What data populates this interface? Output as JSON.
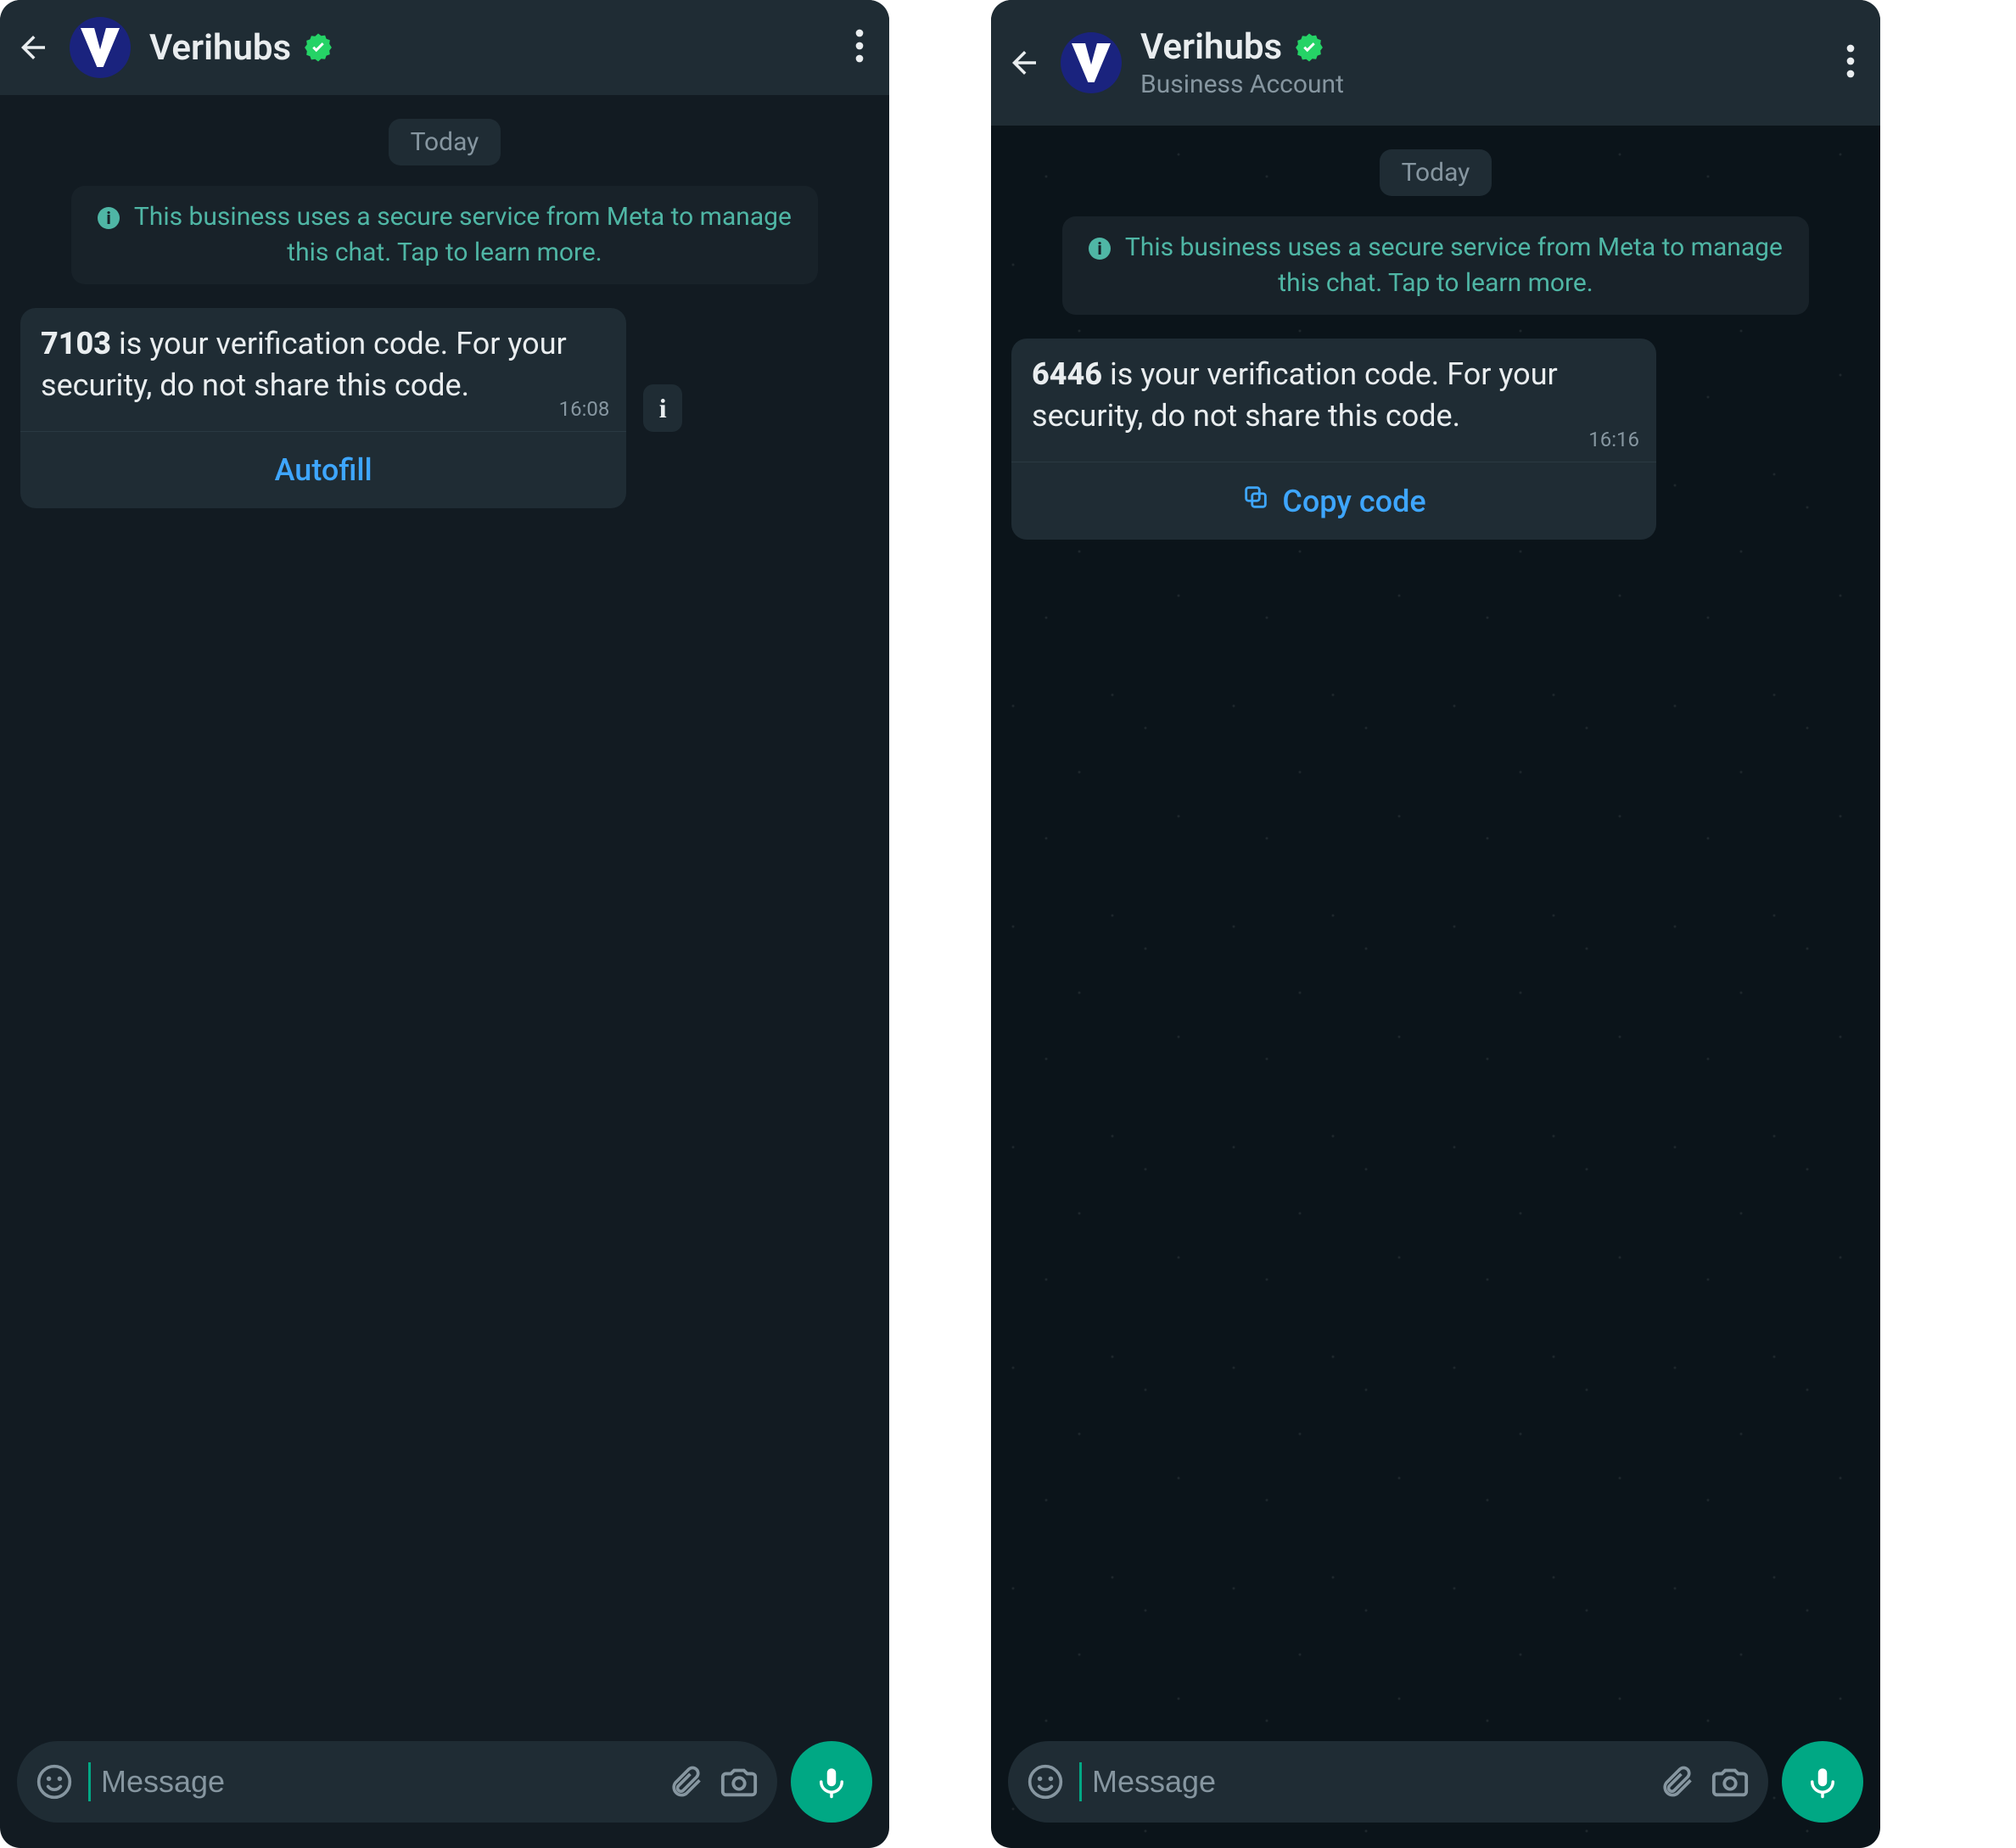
{
  "left": {
    "header": {
      "title": "Verihubs"
    },
    "date_chip": "Today",
    "system_notice": "This business uses a secure service from Meta to manage this chat. Tap to learn more.",
    "message": {
      "code": "7103",
      "rest": " is your verification code. For your security, do not share this code.",
      "time": "16:08",
      "action_label": "Autofill"
    },
    "composer": {
      "placeholder": "Message"
    }
  },
  "right": {
    "header": {
      "title": "Verihubs",
      "subtitle": "Business Account"
    },
    "date_chip": "Today",
    "system_notice": "This business uses a secure service from Meta to manage this chat. Tap to learn more.",
    "message": {
      "code": "6446",
      "rest": " is your verification code. For your security, do not share this code.",
      "time": "16:16",
      "action_label": "Copy code"
    },
    "composer": {
      "placeholder": "Message"
    }
  },
  "colors": {
    "accent": "#00A884",
    "link": "#3EA6FF",
    "verified": "#25D366"
  }
}
